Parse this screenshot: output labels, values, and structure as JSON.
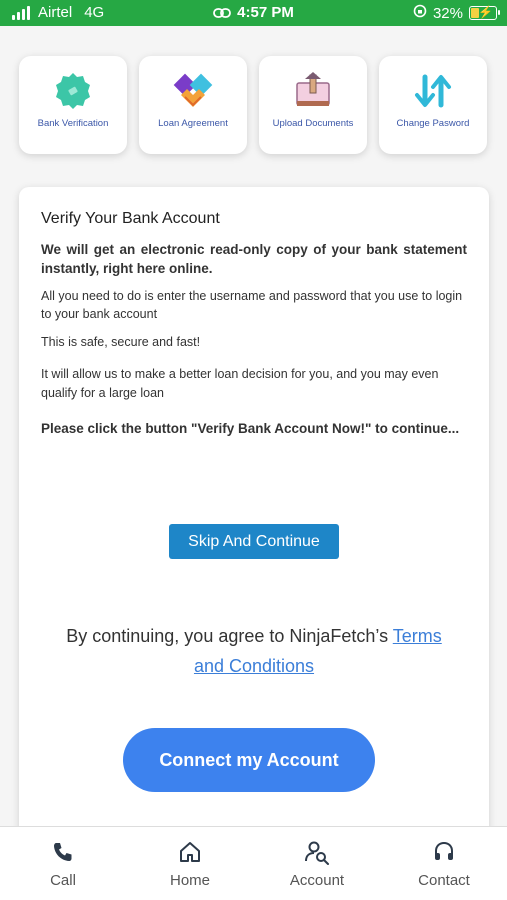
{
  "status_bar": {
    "carrier": "Airtel",
    "network": "4G",
    "time": "4:57 PM",
    "battery": "32%",
    "battery_level": 0.32,
    "color": "#26a844"
  },
  "shortcuts": [
    {
      "label": "Bank Verification",
      "icon": "badge-icon"
    },
    {
      "label": "Loan Agreement",
      "icon": "handshake-icon"
    },
    {
      "label": "Upload Documents",
      "icon": "upload-icon"
    },
    {
      "label": "Change Pasword",
      "icon": "arrows-icon"
    }
  ],
  "card": {
    "title": "Verify Your Bank Account",
    "p1": "We will get an electronic read-only copy of your bank statement instantly, right here online.",
    "p2": "All you need to do is enter the username and password that you use to login to your bank account",
    "p3": "This is safe, secure and fast!",
    "p4": "It will allow us to make a better loan decision for you, and you may even qualify for a large loan",
    "p5": "Please click the button \"Verify Bank Account Now!\" to continue...",
    "skip_label": "Skip And Continue",
    "terms_prefix": "By continuing, you agree to NinjaFetch’s ",
    "terms_link": "Terms and Conditions",
    "connect_label": "Connect my Account"
  },
  "colors": {
    "skip_button": "#1e86c8",
    "connect_button": "#3d82ee",
    "link": "#3b7ed8"
  },
  "bottom_nav": [
    {
      "label": "Call",
      "icon": "phone-icon"
    },
    {
      "label": "Home",
      "icon": "home-icon"
    },
    {
      "label": "Account",
      "icon": "account-search-icon"
    },
    {
      "label": "Contact",
      "icon": "headset-icon"
    }
  ]
}
